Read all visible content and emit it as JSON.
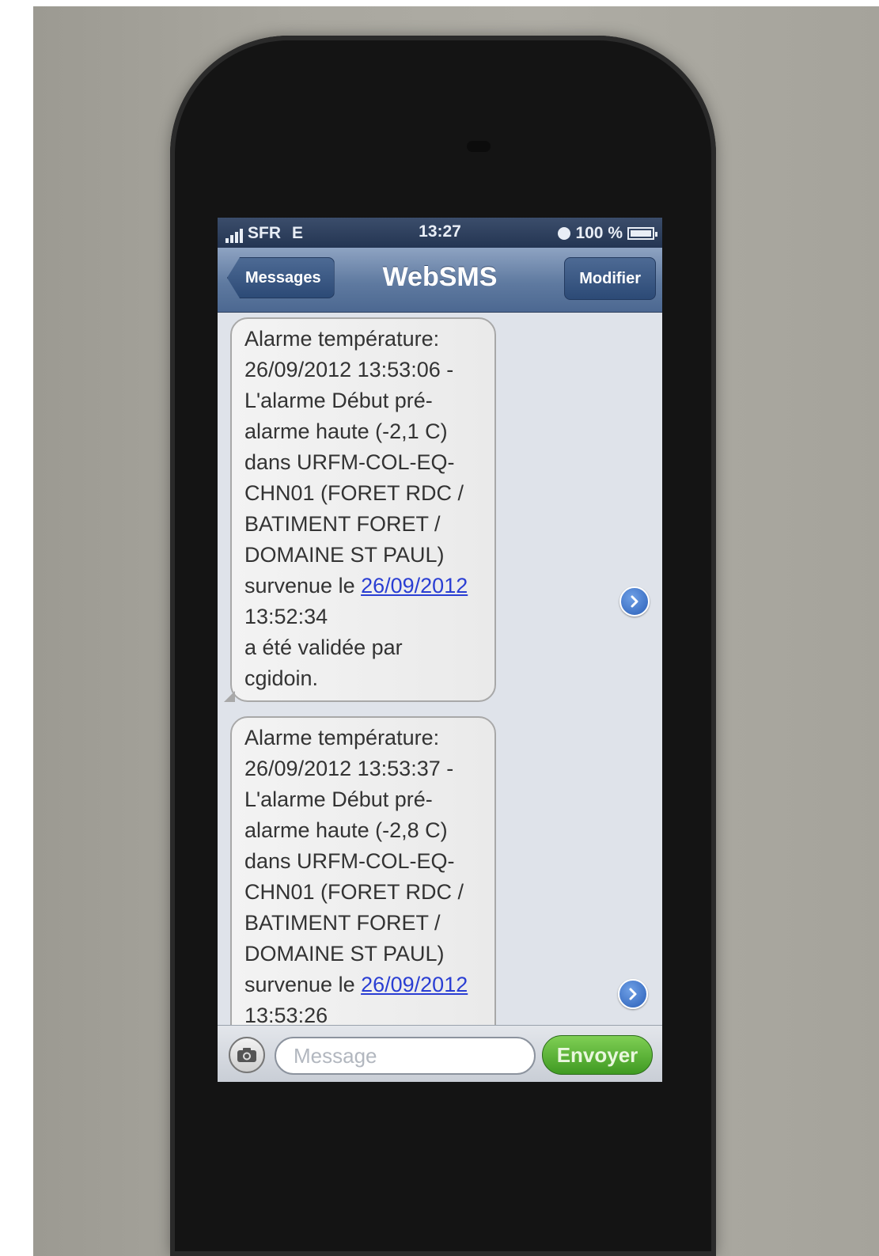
{
  "status_bar": {
    "carrier": "SFR",
    "network": "E",
    "time": "13:27",
    "battery": "100 %"
  },
  "nav": {
    "back_label": "Messages",
    "title": "WebSMS",
    "edit_label": "Modifier"
  },
  "messages": [
    {
      "lines": [
        "Alarme température:",
        "26/09/2012 13:53:06 -",
        "L'alarme  Début pré-",
        "alarme haute (-2,1  C)",
        "dans URFM-COL-EQ-",
        "CHN01 (FORET RDC /",
        "BATIMENT FORET /",
        "DOMAINE ST PAUL)"
      ],
      "prefix": "survenue le ",
      "date_link": "26/09/2012",
      "tail_lines": [
        "13:52:34",
        "a été validée par",
        "cgidoin."
      ]
    },
    {
      "lines": [
        "Alarme température:",
        "26/09/2012 13:53:37 -",
        "L'alarme  Début pré-",
        "alarme haute (-2,8  C)",
        "dans URFM-COL-EQ-",
        "CHN01 (FORET RDC /",
        "BATIMENT FORET /",
        "DOMAINE ST PAUL)"
      ],
      "prefix": "survenue le ",
      "date_link": "26/09/2012",
      "tail_lines": [
        "13:53:26"
      ]
    }
  ],
  "compose": {
    "placeholder": "Message",
    "send_label": "Envoyer"
  },
  "colors": {
    "send_button": "#3f9a22",
    "link": "#2a3ed3",
    "nav_bar": "#5f7aa0"
  }
}
